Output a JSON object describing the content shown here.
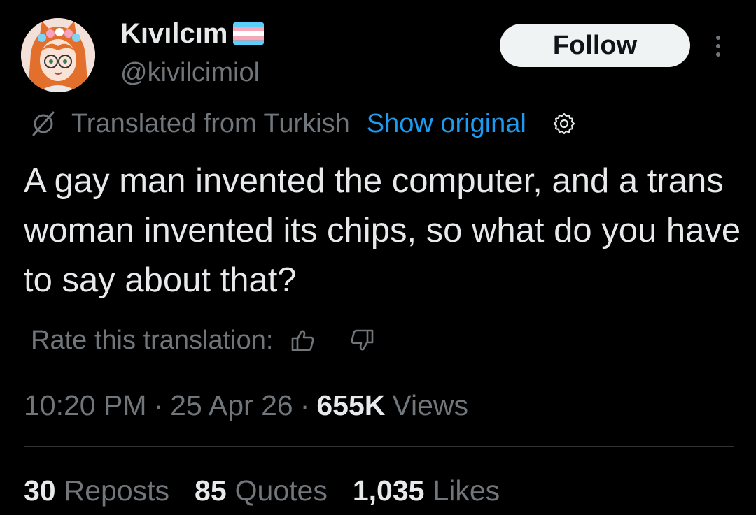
{
  "author": {
    "display_name": "Kıvılcım",
    "handle": "@kivilcimiol",
    "flag_colors": [
      "#5bcefa",
      "#f5a9b8",
      "#ffffff",
      "#f5a9b8",
      "#5bcefa"
    ]
  },
  "follow_label": "Follow",
  "translation": {
    "translated_from": "Translated from Turkish",
    "show_original": "Show original"
  },
  "tweet_text": "A gay man invented the computer, and a trans woman invented its chips, so what do you have to say about that?",
  "rate": {
    "label": "Rate this translation:"
  },
  "meta": {
    "time": "10:20 PM",
    "separator": "·",
    "date": "25 Apr 26",
    "views_count": "655K",
    "views_label": "Views"
  },
  "stats": {
    "reposts_count": "30",
    "reposts_label": "Reposts",
    "quotes_count": "85",
    "quotes_label": "Quotes",
    "likes_count": "1,035",
    "likes_label": "Likes"
  },
  "colors": {
    "background": "#000000",
    "primary_text": "#e7e9ea",
    "secondary_text": "#71767b",
    "link": "#1d9bf0",
    "follow_bg": "#eff3f4"
  }
}
